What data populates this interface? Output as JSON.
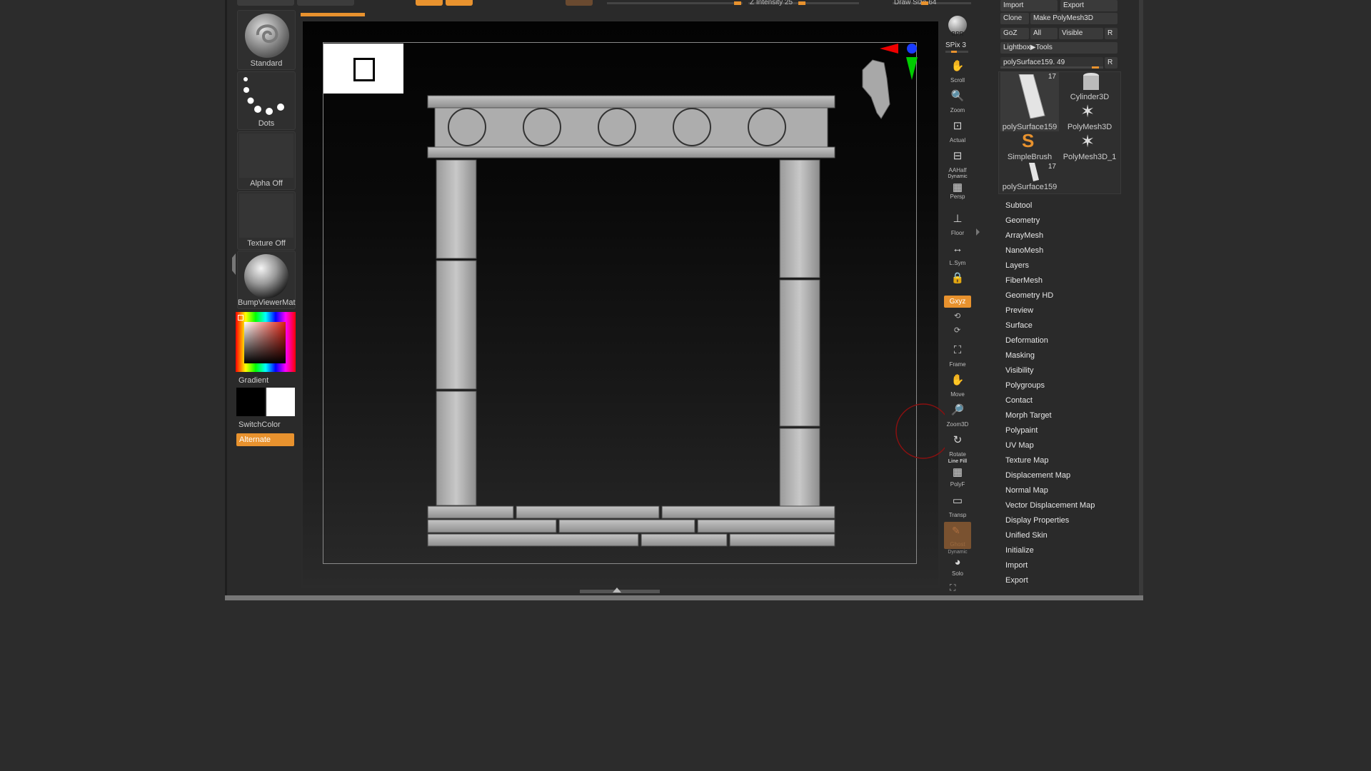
{
  "left_tray": {
    "brush_label": "Standard",
    "stroke_label": "Dots",
    "alpha_label": "Alpha Off",
    "texture_label": "Texture Off",
    "material_label": "BumpViewerMat",
    "gradient_label": "Gradient",
    "switch_color_label": "SwitchColor",
    "alternate_label": "Alternate"
  },
  "shelf": {
    "bpr": "BPR",
    "spix": "SPix 3",
    "scroll": "Scroll",
    "zoom": "Zoom",
    "actual": "Actual",
    "aahalf": "AAHalf",
    "persp_top": "Dynamic",
    "persp": "Persp",
    "floor": "Floor",
    "lsym": "L.Sym",
    "xyz": "Gxyz",
    "frame": "Frame",
    "move": "Move",
    "zoom3d": "Zoom3D",
    "rotate": "Rotate",
    "linefill_top": "Line Fill",
    "polyf": "PolyF",
    "transp": "Transp",
    "ghost": "Ghost",
    "solo_top": "Dynamic",
    "solo": "Solo"
  },
  "tool_palette": {
    "import": "Import",
    "export": "Export",
    "clone": "Clone",
    "make_polymesh": "Make PolyMesh3D",
    "goz": "GoZ",
    "all": "All",
    "visible": "Visible",
    "r": "R",
    "lightbox_tools": "Lightbox▶Tools",
    "current_tool_slider": "polySurface159. 49",
    "tools": [
      {
        "label": "polySurface159",
        "count": "17"
      },
      {
        "label": "Cylinder3D",
        "count": ""
      },
      {
        "label": "polySurface159",
        "count": ""
      },
      {
        "label": "PolyMesh3D",
        "count": ""
      },
      {
        "label": "SimpleBrush",
        "count": ""
      },
      {
        "label": "PolyMesh3D_1",
        "count": ""
      },
      {
        "label": "polySurface159",
        "count": "17"
      }
    ],
    "menu": [
      "Subtool",
      "Geometry",
      "ArrayMesh",
      "NanoMesh",
      "Layers",
      "FiberMesh",
      "Geometry HD",
      "Preview",
      "Surface",
      "Deformation",
      "Masking",
      "Visibility",
      "Polygroups",
      "Contact",
      "Morph Target",
      "Polypaint",
      "UV Map",
      "Texture Map",
      "Displacement Map",
      "Normal Map",
      "Vector Displacement Map",
      "Display Properties",
      "Unified Skin",
      "Initialize",
      "Import",
      "Export"
    ]
  },
  "top_bar": {
    "z_intensity": "Z Intensity 25",
    "draw_size": "Draw Size 64"
  },
  "colors": {
    "accent": "#e8922e",
    "panel": "#2a2a2a",
    "background": "#2c2c2c"
  }
}
